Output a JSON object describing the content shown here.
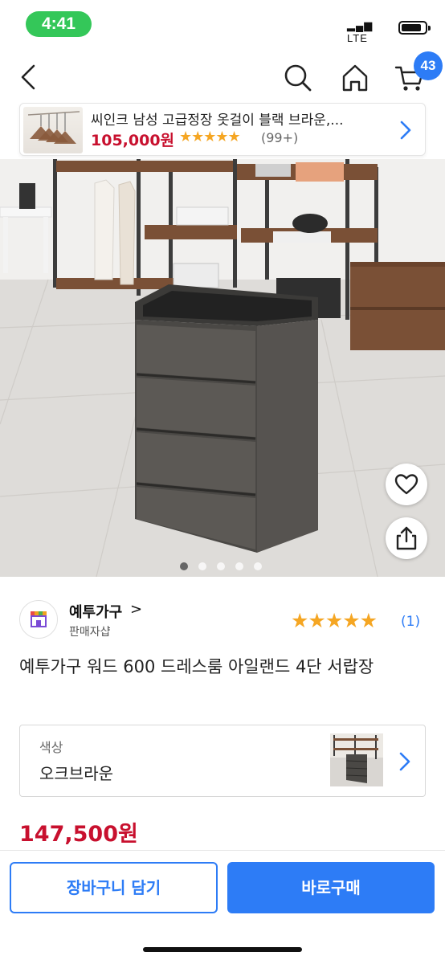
{
  "status_bar": {
    "time": "4:41",
    "network": "LTE"
  },
  "nav": {
    "cart_count": "43"
  },
  "recent_item": {
    "title": "씨인크 남성 고급정장 옷걸이 블랙 브라운,...",
    "price": "105,000원",
    "stars": "★★★★★",
    "review_count": "(99+)"
  },
  "gallery": {
    "total_images": 5,
    "active_index": 0
  },
  "seller": {
    "name": "예투가구",
    "chevron": ">",
    "subtitle": "판매자샵",
    "rating_stars": "★★★★★",
    "rating_count": "(1)"
  },
  "product": {
    "title": "예투가구 워드 600 드레스룸 아일랜드 4단 서랍장",
    "price": "147,500원"
  },
  "option": {
    "label": "색상",
    "value": "오크브라운"
  },
  "actions": {
    "cart_label": "장바구니 담기",
    "buy_label": "바로구매"
  },
  "colors": {
    "accent": "#2d7cf6",
    "price": "#c8102e",
    "star": "#f5a623",
    "status_pill": "#34c759"
  }
}
